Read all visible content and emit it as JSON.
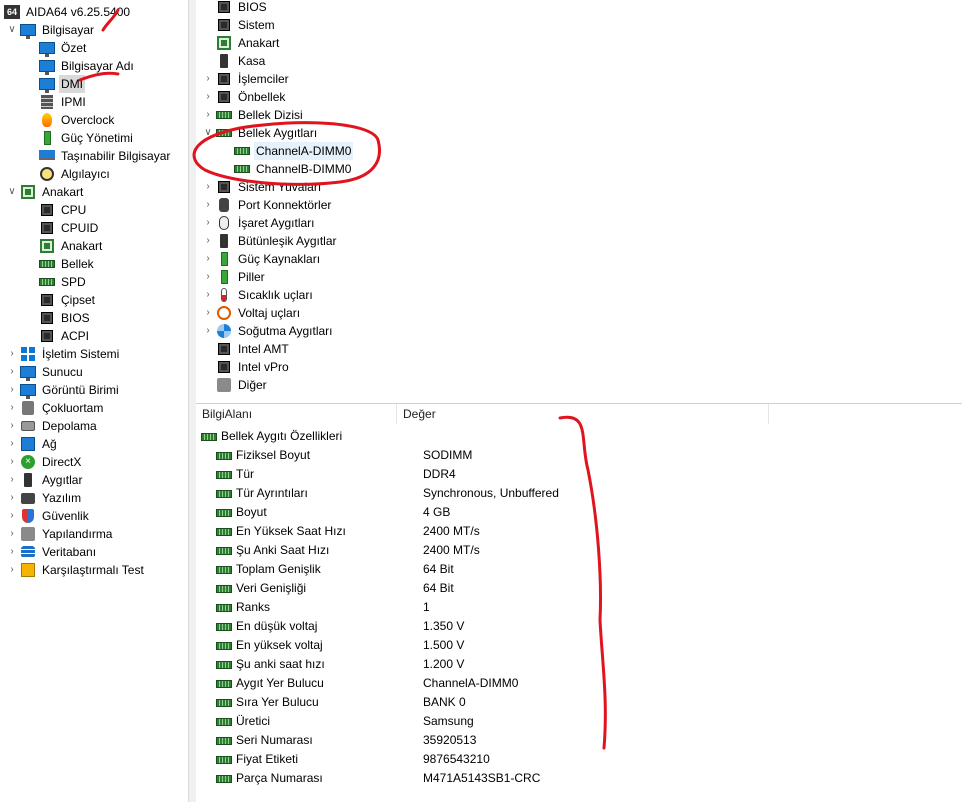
{
  "app": {
    "title": "AIDA64 v6.25.5400",
    "logo_text": "64"
  },
  "left_tree": {
    "items": [
      {
        "label": "Bilgisayar",
        "icon": "computer-icon",
        "expand": "v",
        "indent": 0
      },
      {
        "label": "Özet",
        "icon": "monitor-icon",
        "indent": 1
      },
      {
        "label": "Bilgisayar Adı",
        "icon": "monitor-icon",
        "indent": 1
      },
      {
        "label": "DMI",
        "icon": "monitor-icon",
        "indent": 1,
        "selected": true
      },
      {
        "label": "IPMI",
        "icon": "server-icon",
        "indent": 1
      },
      {
        "label": "Overclock",
        "icon": "fire-icon",
        "indent": 1
      },
      {
        "label": "Güç Yönetimi",
        "icon": "power-icon",
        "indent": 1
      },
      {
        "label": "Taşınabilir Bilgisayar",
        "icon": "laptop-icon",
        "indent": 1
      },
      {
        "label": "Algılayıcı",
        "icon": "gauge-icon",
        "indent": 1
      },
      {
        "label": "Anakart",
        "icon": "motherboard-icon",
        "expand": "v",
        "indent": 0
      },
      {
        "label": "CPU",
        "icon": "chip-icon",
        "indent": 1
      },
      {
        "label": "CPUID",
        "icon": "chip-icon",
        "indent": 1
      },
      {
        "label": "Anakart",
        "icon": "motherboard-icon",
        "indent": 1
      },
      {
        "label": "Bellek",
        "icon": "ram-icon",
        "indent": 1
      },
      {
        "label": "SPD",
        "icon": "ram-icon",
        "indent": 1
      },
      {
        "label": "Çipset",
        "icon": "chip-icon",
        "indent": 1
      },
      {
        "label": "BIOS",
        "icon": "chip-icon",
        "indent": 1
      },
      {
        "label": "ACPI",
        "icon": "chip-icon",
        "indent": 1
      },
      {
        "label": "İşletim Sistemi",
        "icon": "windows-icon",
        "expand": ">",
        "indent": 0
      },
      {
        "label": "Sunucu",
        "icon": "users-icon",
        "expand": ">",
        "indent": 0
      },
      {
        "label": "Görüntü Birimi",
        "icon": "monitor-icon",
        "expand": ">",
        "indent": 0
      },
      {
        "label": "Çokluortam",
        "icon": "speaker-icon",
        "expand": ">",
        "indent": 0
      },
      {
        "label": "Depolama",
        "icon": "drive-icon",
        "expand": ">",
        "indent": 0
      },
      {
        "label": "Ağ",
        "icon": "network-icon",
        "expand": ">",
        "indent": 0
      },
      {
        "label": "DirectX",
        "icon": "xbox-icon",
        "expand": ">",
        "indent": 0
      },
      {
        "label": "Aygıtlar",
        "icon": "device-icon",
        "expand": ">",
        "indent": 0
      },
      {
        "label": "Yazılım",
        "icon": "camera-icon",
        "expand": ">",
        "indent": 0
      },
      {
        "label": "Güvenlik",
        "icon": "shield-icon",
        "expand": ">",
        "indent": 0
      },
      {
        "label": "Yapılandırma",
        "icon": "config-icon",
        "expand": ">",
        "indent": 0
      },
      {
        "label": "Veritabanı",
        "icon": "database-icon",
        "expand": ">",
        "indent": 0
      },
      {
        "label": "Karşılaştırmalı Test",
        "icon": "benchmark-icon",
        "expand": ">",
        "indent": 0
      }
    ]
  },
  "dmi_tree": {
    "items": [
      {
        "label": "BIOS",
        "icon": "chip-icon",
        "indent": 0
      },
      {
        "label": "Sistem",
        "icon": "chip-icon",
        "indent": 0
      },
      {
        "label": "Anakart",
        "icon": "motherboard-icon",
        "indent": 0
      },
      {
        "label": "Kasa",
        "icon": "case-icon",
        "indent": 0
      },
      {
        "label": "İşlemciler",
        "icon": "chip-icon",
        "expand": ">",
        "indent": 0
      },
      {
        "label": "Önbellek",
        "icon": "chip-icon",
        "expand": ">",
        "indent": 0
      },
      {
        "label": "Bellek Dizisi",
        "icon": "ram-icon",
        "expand": ">",
        "indent": 0
      },
      {
        "label": "Bellek Aygıtları",
        "icon": "ram-icon",
        "expand": "v",
        "indent": 0
      },
      {
        "label": "ChannelA-DIMM0",
        "icon": "ram-icon",
        "indent": 1,
        "selected": true
      },
      {
        "label": "ChannelB-DIMM0",
        "icon": "ram-icon",
        "indent": 1
      },
      {
        "label": "Sistem Yuvaları",
        "icon": "slot-icon",
        "expand": ">",
        "indent": 0
      },
      {
        "label": "Port Konnektörler",
        "icon": "port-icon",
        "expand": ">",
        "indent": 0
      },
      {
        "label": "İşaret Aygıtları",
        "icon": "mouse-icon",
        "expand": ">",
        "indent": 0
      },
      {
        "label": "Bütünleşik Aygıtlar",
        "icon": "device-icon",
        "expand": ">",
        "indent": 0
      },
      {
        "label": "Güç Kaynakları",
        "icon": "battery-icon",
        "expand": ">",
        "indent": 0
      },
      {
        "label": "Piller",
        "icon": "battery-icon",
        "expand": ">",
        "indent": 0
      },
      {
        "label": "Sıcaklık uçları",
        "icon": "thermometer-icon",
        "expand": ">",
        "indent": 0
      },
      {
        "label": "Voltaj uçları",
        "icon": "voltage-icon",
        "expand": ">",
        "indent": 0
      },
      {
        "label": "Soğutma Aygıtları",
        "icon": "fan-icon",
        "expand": ">",
        "indent": 0
      },
      {
        "label": "Intel AMT",
        "icon": "chip-icon",
        "indent": 0
      },
      {
        "label": "Intel vPro",
        "icon": "chip-icon",
        "indent": 0
      },
      {
        "label": "Diğer",
        "icon": "gear-icon",
        "indent": 0
      }
    ]
  },
  "details": {
    "col_field": "BilgiAlanı",
    "col_value": "Değer",
    "group_label": "Bellek Aygıtı Özellikleri",
    "rows": [
      {
        "field": "Fiziksel Boyut",
        "value": "SODIMM"
      },
      {
        "field": "Tür",
        "value": "DDR4"
      },
      {
        "field": "Tür Ayrıntıları",
        "value": "Synchronous, Unbuffered"
      },
      {
        "field": "Boyut",
        "value": "4 GB"
      },
      {
        "field": "En Yüksek Saat Hızı",
        "value": "2400 MT/s"
      },
      {
        "field": "Şu Anki Saat Hızı",
        "value": "2400 MT/s"
      },
      {
        "field": "Toplam Genişlik",
        "value": "64 Bit"
      },
      {
        "field": "Veri Genişliği",
        "value": "64 Bit"
      },
      {
        "field": "Ranks",
        "value": "1"
      },
      {
        "field": "En düşük voltaj",
        "value": "1.350 V"
      },
      {
        "field": "En yüksek voltaj",
        "value": "1.500 V"
      },
      {
        "field": "Şu anki saat hızı",
        "value": "1.200 V"
      },
      {
        "field": "Aygıt Yer Bulucu",
        "value": "ChannelA-DIMM0"
      },
      {
        "field": "Sıra Yer Bulucu",
        "value": "BANK 0"
      },
      {
        "field": "Üretici",
        "value": "Samsung"
      },
      {
        "field": "Seri Numarası",
        "value": "35920513"
      },
      {
        "field": "Fiyat Etiketi",
        "value": "9876543210"
      },
      {
        "field": "Parça Numarası",
        "value": "M471A5143SB1-CRC"
      }
    ]
  },
  "annotation_color": "#e0141e"
}
